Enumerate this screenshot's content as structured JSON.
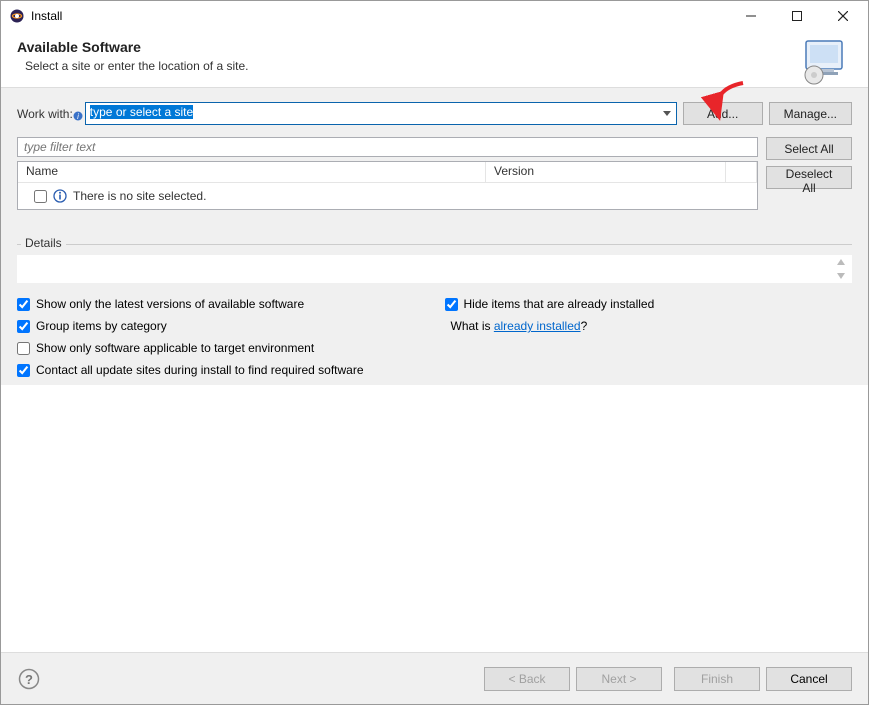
{
  "window": {
    "title": "Install"
  },
  "header": {
    "title": "Available Software",
    "subtitle": "Select a site or enter the location of a site."
  },
  "workwith": {
    "label": "Work with:",
    "selected_text": "type or select a site",
    "add_label": "Add...",
    "manage_label": "Manage..."
  },
  "filter": {
    "placeholder": "type filter text"
  },
  "side": {
    "select_all": "Select All",
    "deselect_all": "Deselect All"
  },
  "tree": {
    "col_name": "Name",
    "col_version": "Version",
    "empty_msg": "There is no site selected."
  },
  "details": {
    "legend": "Details"
  },
  "options": {
    "show_latest": "Show only the latest versions of available software",
    "hide_installed": "Hide items that are already installed",
    "group_by_category": "Group items by category",
    "already_installed_prefix": "What is ",
    "already_installed_link": "already installed",
    "already_installed_suffix": "?",
    "show_applicable": "Show only software applicable to target environment",
    "contact_all": "Contact all update sites during install to find required software"
  },
  "buttons": {
    "back": "< Back",
    "next": "Next >",
    "finish": "Finish",
    "cancel": "Cancel"
  }
}
